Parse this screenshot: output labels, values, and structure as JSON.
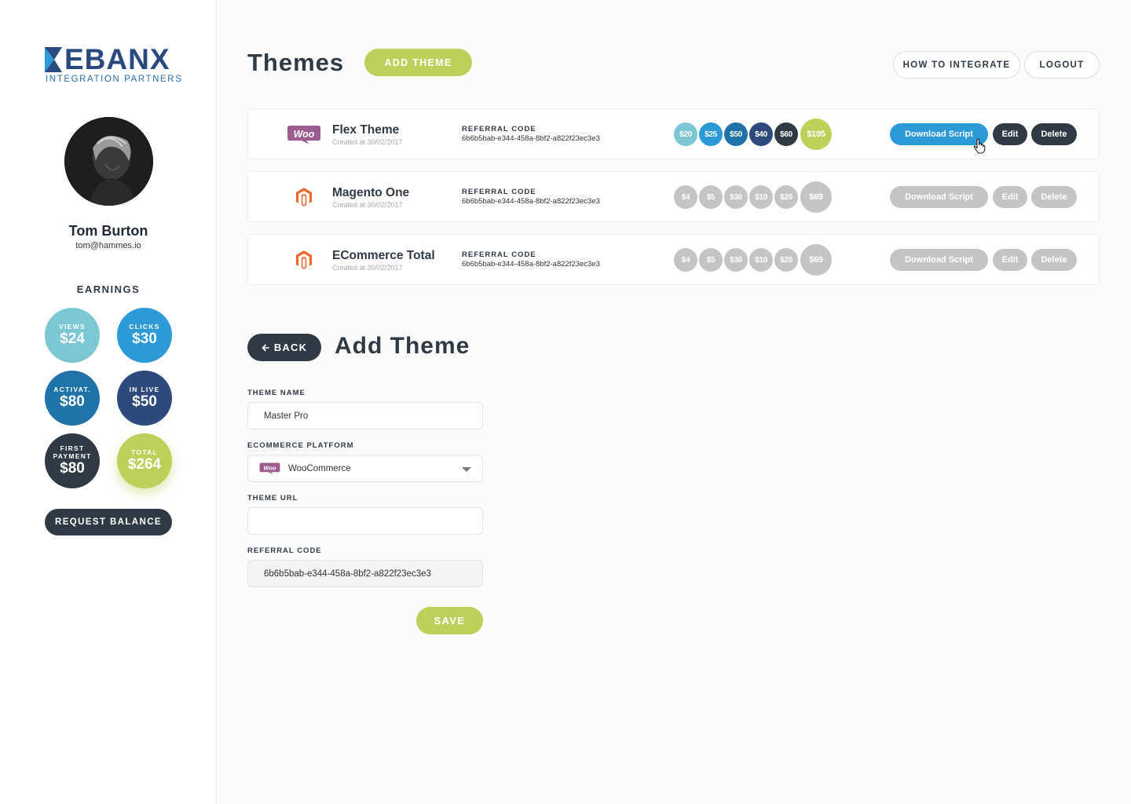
{
  "brand": {
    "name": "EBANX",
    "subtitle": "INTEGRATION PARTNERS",
    "color": "#2a4a7f"
  },
  "user": {
    "name": "Tom Burton",
    "email": "tom@hammes.io"
  },
  "earnings": {
    "title": "EARNINGS",
    "items": [
      {
        "label": "VIEWS",
        "value": "$24",
        "color": "#7cc7d4"
      },
      {
        "label": "CLICKS",
        "value": "$30",
        "color": "#2d9ad8"
      },
      {
        "label": "ACTIVAT.",
        "value": "$80",
        "color": "#1f73a8"
      },
      {
        "label": "IN LIVE",
        "value": "$50",
        "color": "#2e4a7d"
      },
      {
        "label": "FIRST PAYMENT",
        "value": "$80",
        "color": "#2f3a45"
      },
      {
        "label": "TOTAL",
        "value": "$264",
        "color": "#bcd05a"
      }
    ],
    "request_label": "REQUEST BALANCE"
  },
  "header": {
    "title": "Themes",
    "add_label": "ADD THEME",
    "integrate_label": "HOW TO INTEGRATE",
    "logout_label": "LOGOUT"
  },
  "themes": {
    "ref_label": "REFERRAL CODE",
    "download_label": "Download Script",
    "edit_label": "Edit",
    "delete_label": "Delete",
    "items": [
      {
        "name": "Flex Theme",
        "created": "Created at 30/02/2017",
        "platform_icon": "woocommerce-icon",
        "referral_code": "6b6b5bab-e344-458a-8bf2-a822f23ec3e3",
        "active": true,
        "chips": [
          "$20",
          "$25",
          "$50",
          "$40",
          "$60",
          "$195"
        ]
      },
      {
        "name": "Magento One",
        "created": "Created at 30/02/2017",
        "platform_icon": "magento-icon",
        "referral_code": "6b6b5bab-e344-458a-8bf2-a822f23ec3e3",
        "active": false,
        "chips": [
          "$4",
          "$5",
          "$30",
          "$10",
          "$20",
          "$69"
        ]
      },
      {
        "name": "ECommerce Total",
        "created": "Created at 30/02/2017",
        "platform_icon": "magento-icon",
        "referral_code": "6b6b5bab-e344-458a-8bf2-a822f23ec3e3",
        "active": false,
        "chips": [
          "$4",
          "$5",
          "$30",
          "$10",
          "$20",
          "$69"
        ]
      }
    ]
  },
  "colors": {
    "chips_active": [
      "#7cc7d4",
      "#2d9ad8",
      "#1f73a8",
      "#2e4a7d",
      "#2f3a45",
      "#bcd05a"
    ],
    "chip_inactive": "#c4c4c4",
    "download_active": "#2d9ad8",
    "dark_button": "#2f3a45",
    "inactive_button": "#c4c4c4"
  },
  "form": {
    "back_label": "BACK",
    "title": "Add Theme",
    "theme_name_label": "THEME NAME",
    "theme_name_value": "Master Pro",
    "platform_label": "ECOMMERCE PLATFORM",
    "platform_value": "WooCommerce",
    "theme_url_label": "THEME URL",
    "theme_url_value": "",
    "referral_label": "REFERRAL CODE",
    "referral_value": "6b6b5bab-e344-458a-8bf2-a822f23ec3e3",
    "save_label": "SAVE"
  }
}
